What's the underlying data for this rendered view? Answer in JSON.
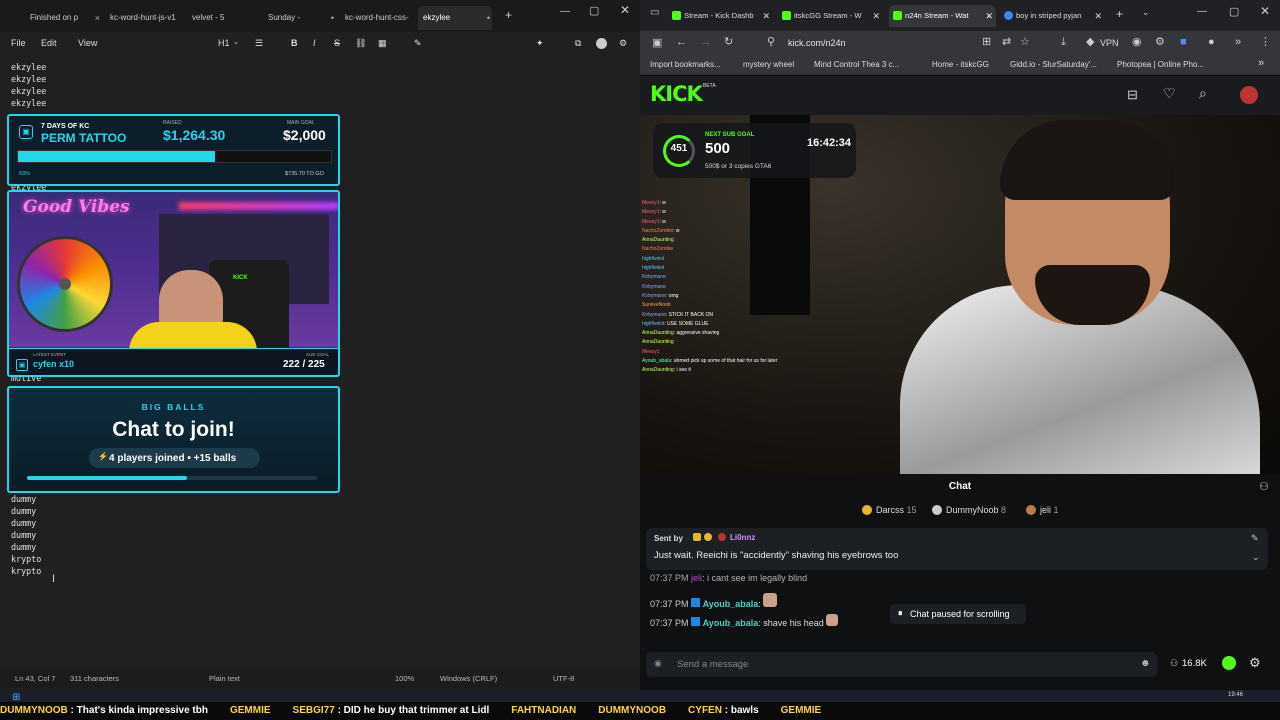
{
  "notepad": {
    "tabs": [
      {
        "label": "Finished on p"
      },
      {
        "label": "kc-word-hunt-js-v1"
      },
      {
        "label": "velvet - 5"
      },
      {
        "label": "Sunday -"
      },
      {
        "label": "kc-word-hunt-css-"
      },
      {
        "label": "ekzylee"
      }
    ],
    "menu": {
      "file": "File",
      "edit": "Edit",
      "view": "View",
      "heading": "H1"
    },
    "lines_top": [
      "ekzylee",
      "ekzylee",
      "ekzylee",
      "ekzylee"
    ],
    "lines_mid_partial": [
      "ekzylee",
      "motive"
    ],
    "lines_bottom": [
      "dummy",
      "dummy",
      "dummy",
      "dummy",
      "dummy",
      "krypto",
      "krypto"
    ],
    "status": {
      "position": "Ln 43, Col 7",
      "chars": "311 characters",
      "format": "Plain text",
      "zoom": "100%",
      "eol": "Windows (CRLF)",
      "encoding": "UTF-8"
    }
  },
  "overlays": {
    "tattoo": {
      "subtitle": "7 DAYS OF KC",
      "title": "PERM TATTOO",
      "raised_label": "RAISED",
      "raised": "$1,264.30",
      "goal_label": "MAIN GOAL",
      "goal": "$2,000",
      "percent": "63%",
      "progress": 0.63,
      "remaining": "$735.70 TO GO"
    },
    "cam": {
      "sign": "Good Vibes",
      "chair_text": "KICK",
      "event_label": "LATEST EVENT",
      "event": "cyfen x10",
      "sub_label": "SUB GOAL",
      "sub_progress": "222 / 225"
    },
    "balls": {
      "header": "BIG BALLS",
      "title": "Chat to join!",
      "subtitle": "4 players joined • +15 balls",
      "progress": 0.55
    }
  },
  "browser": {
    "tabs": [
      {
        "label": "Stream - Kick Dashb"
      },
      {
        "label": "itskcGG Stream - W"
      },
      {
        "label": "n24n Stream - Wat"
      },
      {
        "label": "boy in striped pyjan"
      }
    ],
    "url": "kick.com/n24n",
    "vpn": "VPN",
    "bookmarks": [
      "Import bookmarks...",
      "mystery wheel",
      "Mind Control Thea 3 c...",
      "Home - itskcGG",
      "Gidd.io - SlurSaturday'...",
      "Photopea | Online Pho..."
    ],
    "logo": "KICK",
    "logo_badge": "BETA",
    "sub_goal": {
      "count": "451",
      "label": "NEXT SUB GOAL",
      "value": "500",
      "note": "500$ or 3 copies GTA6",
      "timer": "16:42:34"
    },
    "stream_chat": [
      {
        "user": "Meezy1",
        "msg": "w"
      },
      {
        "user": "Meezy1",
        "msg": "w"
      },
      {
        "user": "Meezy1",
        "msg": "w"
      },
      {
        "user": "NachoZombie",
        "msg": "w"
      },
      {
        "user": "AnnaDaunting",
        "msg": ""
      },
      {
        "user": "NachoZombie",
        "msg": ""
      },
      {
        "user": "highfivelol",
        "msg": ""
      },
      {
        "user": "highfivelol",
        "msg": ""
      },
      {
        "user": "Kirbymane",
        "msg": ""
      },
      {
        "user": "Kirbymane",
        "msg": ""
      },
      {
        "user": "Kirbymane",
        "msg": "omg"
      },
      {
        "user": "SurviveNoob",
        "msg": ""
      },
      {
        "user": "Kirbymane",
        "msg": "STICK IT BACK ON"
      },
      {
        "user": "highfivelol",
        "msg": "USE SOME GLUE"
      },
      {
        "user": "AnnaDaunting",
        "msg": "aggressive shaving"
      },
      {
        "user": "AnnaDaunting",
        "msg": ""
      },
      {
        "user": "Meezy1",
        "msg": ""
      },
      {
        "user": "Ayoub_abala",
        "msg": "ahmed pick up some of that hair for us for later"
      },
      {
        "user": "AnnaDaunting",
        "msg": "i see it"
      }
    ],
    "chat": {
      "title": "Chat",
      "leaders": [
        {
          "rank": "1",
          "name": "Darcss",
          "count": "15"
        },
        {
          "rank": "2",
          "name": "DummyNoob",
          "count": "8"
        },
        {
          "rank": "3",
          "name": "jeli",
          "count": "1"
        }
      ],
      "pinned_label": "Sent by",
      "pinned_user": "Li0nnz",
      "pinned_msg": "Just wait. Reeichi is \"accidently\" shaving his eyebrows too",
      "messages": [
        {
          "time": "07:37 PM",
          "user": "jeli",
          "msg": "i cant see im legally blind"
        },
        {
          "time": "07:37 PM",
          "user": "Ayoub_abala",
          "msg": ""
        },
        {
          "time": "07:37 PM",
          "user": "Ayoub_abala",
          "msg": "shave his head"
        }
      ],
      "paused": "Chat paused for scrolling",
      "input_placeholder": "Send a message",
      "viewers": "16.8K"
    }
  },
  "ticker": [
    {
      "user": "DUMMYNOOB",
      "msg": "That's kinda impressive tbh"
    },
    {
      "user": "GEMMIE",
      "msg": ""
    },
    {
      "user": "SEBGI77",
      "msg": "DID he buy that trimmer at Lidl"
    },
    {
      "user": "FAHTNADIAN",
      "msg": ""
    },
    {
      "user": "DUMMYNOOB",
      "msg": ""
    },
    {
      "user": "CYFEN",
      "msg": "bawls"
    },
    {
      "user": "GEMMIE",
      "msg": ""
    }
  ],
  "clock": "19:46"
}
